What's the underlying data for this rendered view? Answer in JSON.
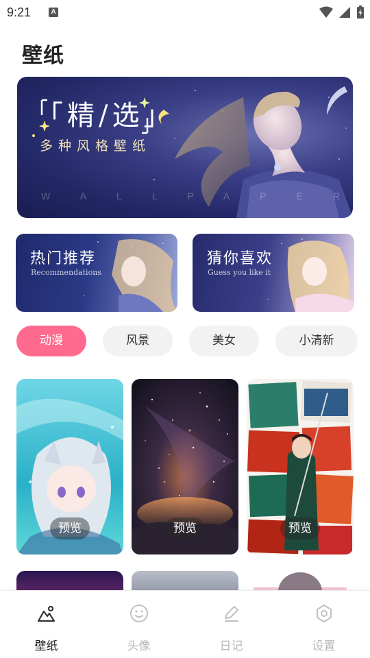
{
  "status": {
    "time": "9:21",
    "a_badge": "A"
  },
  "page_title": "壁纸",
  "banner": {
    "title": "「精/选」",
    "subtitle": "多种风格壁纸",
    "watermark": "WALLPAPER"
  },
  "cards": [
    {
      "title": "热门推荐",
      "subtitle": "Recommendations"
    },
    {
      "title": "猜你喜欢",
      "subtitle": "Guess you like it"
    }
  ],
  "categories": [
    {
      "label": "动漫",
      "active": true
    },
    {
      "label": "风景",
      "active": false
    },
    {
      "label": "美女",
      "active": false
    },
    {
      "label": "小清新",
      "active": false
    }
  ],
  "tiles": [
    {
      "preview_label": "预览"
    },
    {
      "preview_label": "预览"
    },
    {
      "preview_label": "预览"
    }
  ],
  "nav": [
    {
      "label": "壁纸",
      "icon": "wallpaper-icon",
      "active": true
    },
    {
      "label": "头像",
      "icon": "smiley-icon",
      "active": false
    },
    {
      "label": "日记",
      "icon": "pen-icon",
      "active": false
    },
    {
      "label": "设置",
      "icon": "settings-icon",
      "active": false
    }
  ],
  "colors": {
    "accent": "#ff6b8e",
    "chip_bg": "#f2f2f2",
    "nav_inactive": "#b8b8b8"
  }
}
